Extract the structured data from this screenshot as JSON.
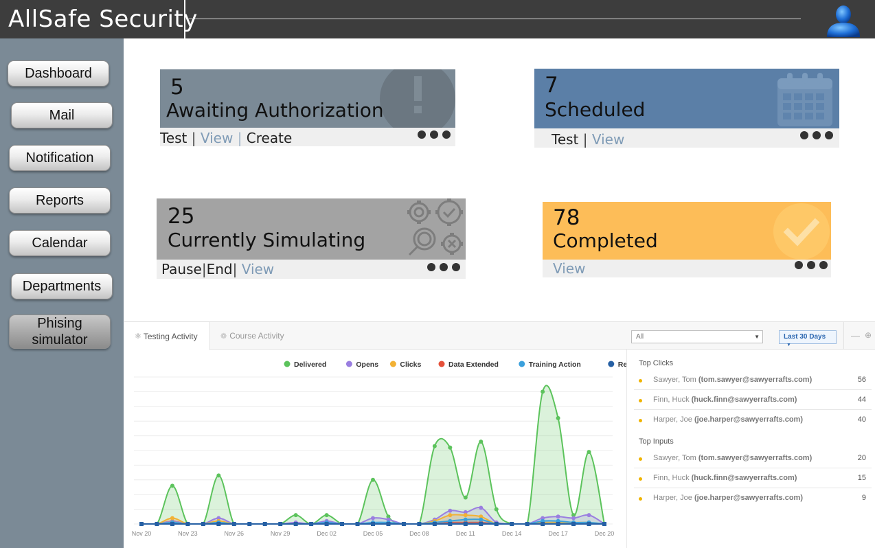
{
  "header": {
    "app_title": "AllSafe Security",
    "user_icon": "user-icon"
  },
  "sidebar": {
    "items": [
      {
        "label": "Dashboard"
      },
      {
        "label": "Mail"
      },
      {
        "label": "Notification"
      },
      {
        "label": "Reports"
      },
      {
        "label": "Calendar"
      },
      {
        "label": "Departments"
      },
      {
        "label": "Phising simulator",
        "line1": "Phising",
        "line2": "simulator"
      }
    ]
  },
  "cards": {
    "awaiting": {
      "count": "5",
      "label": "Awaiting Authorization",
      "actions": [
        "Test",
        "View",
        "Create"
      ],
      "icon": "exclamation-icon",
      "color": "#7b8a96"
    },
    "scheduled": {
      "count": "7",
      "label": "Scheduled",
      "actions": [
        "Test",
        "View"
      ],
      "icon": "calendar-icon",
      "color": "#5b7fa7"
    },
    "simulating": {
      "count": "25",
      "label": "Currently Simulating",
      "actions": [
        "Pause",
        "End",
        "View"
      ],
      "icon": "gears-icon",
      "color": "#a3a3a3"
    },
    "completed": {
      "count": "78",
      "label": "Completed",
      "actions": [
        "View"
      ],
      "icon": "checkmark-icon",
      "color": "#fdbd58"
    }
  },
  "activity": {
    "tabs": [
      "Testing Activity",
      "Course Activity"
    ],
    "filter_value": "All",
    "range_label": "Last 30 Days",
    "top_clicks_title": "Top Clicks",
    "top_clicks": [
      {
        "name": "Sawyer, Tom",
        "email": "(tom.sawyer@sawyerrafts.com)",
        "count": "56"
      },
      {
        "name": "Finn, Huck",
        "email": "(huck.finn@sawyerrafts.com)",
        "count": "44"
      },
      {
        "name": "Harper, Joe",
        "email": "(joe.harper@sawyerrafts.com)",
        "count": "40"
      }
    ],
    "top_inputs_title": "Top Inputs",
    "top_inputs": [
      {
        "name": "Sawyer, Tom",
        "email": "(tom.sawyer@sawyerrafts.com)",
        "count": "20"
      },
      {
        "name": "Finn, Huck",
        "email": "(huck.finn@sawyerrafts.com)",
        "count": "15"
      },
      {
        "name": "Harper, Joe",
        "email": "(joe.harper@sawyerrafts.com)",
        "count": "9"
      }
    ]
  },
  "chart_data": {
    "type": "area",
    "x": [
      "Nov 20",
      "Nov 21",
      "Nov 22",
      "Nov 23",
      "Nov 24",
      "Nov 25",
      "Nov 26",
      "Nov 27",
      "Nov 28",
      "Nov 29",
      "Nov 30",
      "Dec 01",
      "Dec 02",
      "Dec 03",
      "Dec 04",
      "Dec 05",
      "Dec 06",
      "Dec 07",
      "Dec 08",
      "Dec 09",
      "Dec 10",
      "Dec 11",
      "Dec 12",
      "Dec 13",
      "Dec 14",
      "Dec 15",
      "Dec 16",
      "Dec 17",
      "Dec 18",
      "Dec 19",
      "Dec 20"
    ],
    "tick_labels": [
      "Nov 20",
      "Nov 23",
      "Nov 26",
      "Nov 29",
      "Dec 02",
      "Dec 05",
      "Dec 08",
      "Dec 11",
      "Dec 14",
      "Dec 17",
      "Dec 20"
    ],
    "ylim": [
      0,
      100
    ],
    "grid": true,
    "legend_position": "top-right",
    "series": [
      {
        "name": "Delivered",
        "color": "#5cc35c",
        "values": [
          0,
          0,
          26,
          0,
          0,
          33,
          0,
          0,
          0,
          0,
          6,
          0,
          6,
          0,
          0,
          30,
          5,
          0,
          0,
          53,
          52,
          18,
          56,
          10,
          0,
          0,
          90,
          72,
          6,
          49,
          0
        ]
      },
      {
        "name": "Opens",
        "color": "#9a7ee0",
        "values": [
          0,
          0,
          2,
          0,
          0,
          4,
          0,
          0,
          0,
          0,
          1,
          0,
          2,
          0,
          0,
          4,
          3,
          0,
          0,
          3,
          9,
          8,
          11,
          1,
          0,
          0,
          4,
          5,
          4,
          6,
          0
        ]
      },
      {
        "name": "Clicks",
        "color": "#f2b134",
        "values": [
          0,
          0,
          4,
          0,
          0,
          2,
          0,
          0,
          0,
          0,
          0,
          0,
          0,
          0,
          0,
          0,
          0,
          0,
          0,
          2,
          6,
          6,
          5,
          0,
          0,
          0,
          1,
          1,
          1,
          1,
          0
        ]
      },
      {
        "name": "Data Extended",
        "color": "#e55039",
        "values": [
          0,
          0,
          0,
          0,
          0,
          0,
          0,
          0,
          0,
          0,
          0,
          0,
          0,
          0,
          0,
          0,
          0,
          0,
          0,
          0,
          1,
          1,
          1,
          0,
          0,
          0,
          0,
          0,
          0,
          0,
          0
        ]
      },
      {
        "name": "Training Action",
        "color": "#3aa0dc",
        "values": [
          0,
          0,
          1,
          0,
          0,
          1,
          0,
          0,
          0,
          0,
          0,
          0,
          1,
          0,
          0,
          1,
          1,
          0,
          0,
          1,
          2,
          3,
          3,
          0,
          0,
          0,
          2,
          2,
          1,
          1,
          0
        ]
      },
      {
        "name": "Reported",
        "color": "#2660a4",
        "values": [
          0,
          0,
          0,
          0,
          0,
          0,
          0,
          0,
          0,
          0,
          0,
          0,
          0,
          0,
          0,
          0,
          0,
          0,
          0,
          0,
          0,
          0,
          0,
          0,
          0,
          0,
          0,
          0,
          0,
          0,
          0
        ]
      }
    ]
  }
}
